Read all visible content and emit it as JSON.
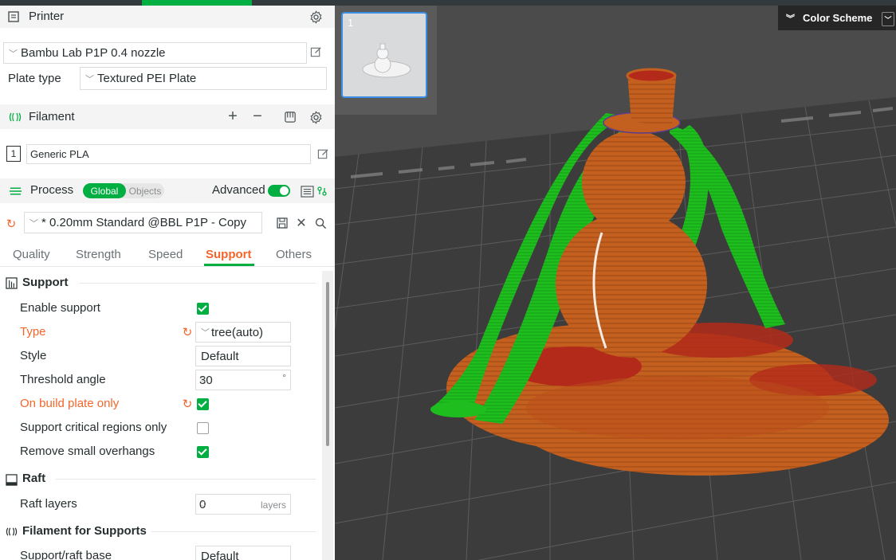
{
  "printer": {
    "title": "Printer",
    "printer_name": "Bambu Lab P1P 0.4 nozzle",
    "plate_type_label": "Plate type",
    "plate_type_value": "Textured PEI Plate"
  },
  "filament": {
    "title": "Filament",
    "slot_number": "1",
    "filament_name": "Generic PLA"
  },
  "process": {
    "title": "Process",
    "global_label": "Global",
    "objects_label": "Objects",
    "advanced_label": "Advanced",
    "preset_name": "* 0.20mm Standard @BBL P1P - Copy"
  },
  "tabs": [
    "Quality",
    "Strength",
    "Speed",
    "Support",
    "Others"
  ],
  "support": {
    "section_title": "Support",
    "enable_support_label": "Enable support",
    "enable_support_checked": true,
    "type_label": "Type",
    "type_value": "tree(auto)",
    "style_label": "Style",
    "style_value": "Default",
    "threshold_label": "Threshold angle",
    "threshold_value": "30",
    "threshold_unit": "°",
    "build_plate_label": "On build plate only",
    "build_plate_checked": true,
    "critical_label": "Support critical regions only",
    "critical_checked": false,
    "small_overhangs_label": "Remove small overhangs",
    "small_overhangs_checked": true
  },
  "raft": {
    "section_title": "Raft",
    "raft_layers_label": "Raft layers",
    "raft_layers_value": "0",
    "raft_layers_unit": "layers"
  },
  "filament_supports": {
    "section_title": "Filament for Supports",
    "base_label": "Support/raft base",
    "base_value": "Default"
  },
  "viewport": {
    "plate_number": "1",
    "color_scheme_label": "Color Scheme"
  },
  "colors": {
    "accent": "#00ae42",
    "modified": "#f3662b",
    "selection": "#3a8ee6",
    "model": "#c4601f",
    "support": "#1fbe1f",
    "bed": "#4b4b4b"
  }
}
